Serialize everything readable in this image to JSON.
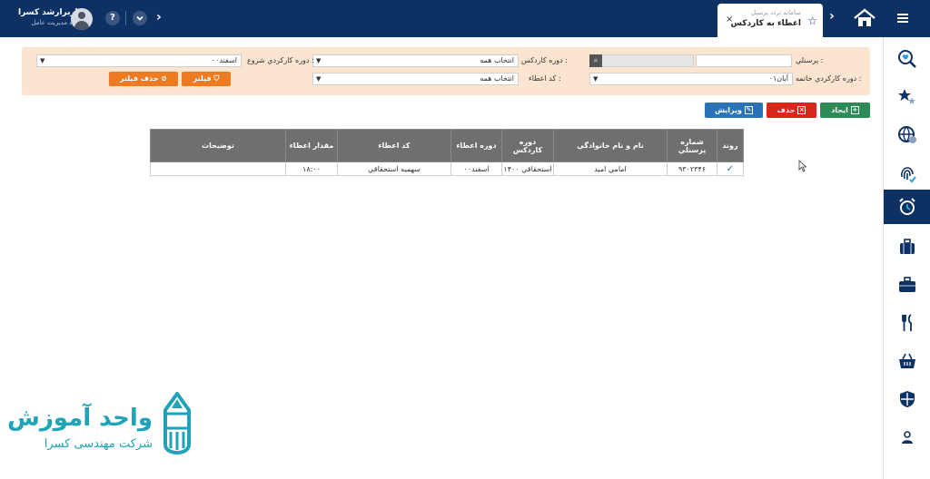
{
  "header": {
    "user_name": "کاربرارشد کسرا",
    "user_role": "حوزه مدیریت عامل",
    "help_label": "?",
    "tab": {
      "system_name": "سامانه تردد پرسنل",
      "title": "اعطاء به کاردکس",
      "close_label": "×"
    }
  },
  "filters": {
    "personnel_label": "پرسنلي :",
    "kardex_period_label": "دوره کاردکس :",
    "kardex_period_value": "انتخاب همه",
    "start_period_label": "دوره کارکردي شروع :",
    "start_period_value": "اسفند۰۰",
    "end_period_label": "دوره کارکردي خاتمه :",
    "end_period_value": "آبان۰۱",
    "grant_code_label": "کد اعطاء :",
    "grant_code_value": "انتخاب همه",
    "filter_button": "فيلتر",
    "clear_filter_button": "حذف فيلتر"
  },
  "actions": {
    "create": "ايجاد",
    "delete": "حذف",
    "edit": "ويرايش"
  },
  "table": {
    "columns": [
      "روند",
      "شماره پرسنلي",
      "نام و نام خانوادگي",
      "دوره کاردکس",
      "دوره اعطاء",
      "کد اعطاء",
      "مقدار اعطاء",
      "توضيحات"
    ],
    "rows": [
      {
        "status_icon": "check-icon",
        "personnel_no": "۹۳۰۲۳۴۶",
        "full_name": "امامي اميد",
        "kardex_period": "استحقاقي ۱۴۰۰",
        "grant_period": "اسفند۰۰",
        "grant_code": "سهميه استحقاقي",
        "grant_amount": "۱۸:۰۰",
        "description": ""
      }
    ]
  },
  "logo": {
    "title": "واحد آموزش",
    "subtitle": "شرکت مهندسی کسرا"
  },
  "colors": {
    "header_bg": "#0d3163",
    "filter_bg": "#fbe4d0",
    "orange": "#ee7a22",
    "create_green": "#2e8b57",
    "delete_red": "#d9261c",
    "edit_blue": "#2a73b8",
    "table_header": "#6f6f6f",
    "logo_teal": "#1ea3b8"
  }
}
